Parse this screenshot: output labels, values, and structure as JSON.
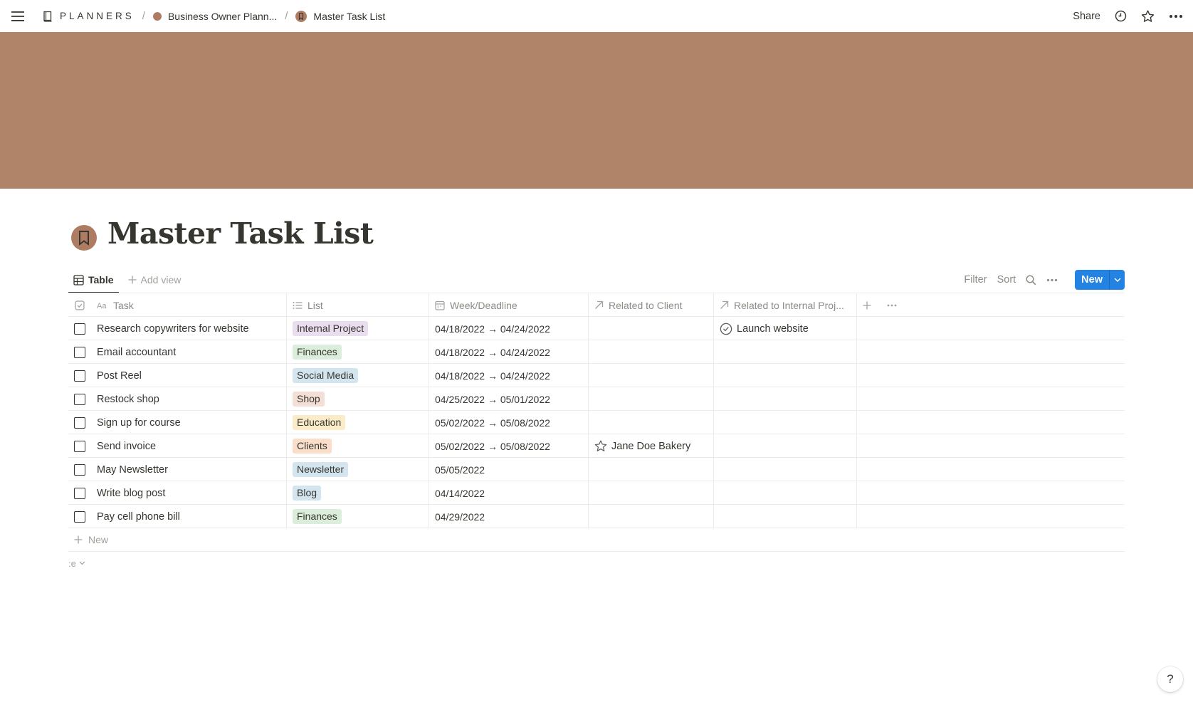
{
  "topbar": {
    "menu_icon": "hamburger-icon",
    "breadcrumbs": [
      {
        "label": "PLANNERS",
        "icon": "book-icon"
      },
      {
        "label": "Business Owner Plann...",
        "icon": "brown-dot-icon"
      },
      {
        "label": "Master Task List",
        "icon": "bookmark-icon"
      }
    ],
    "share_label": "Share",
    "right_icons": [
      "clock-icon",
      "star-icon",
      "more-icon"
    ]
  },
  "colors": {
    "cover": "#b08468",
    "page_icon_bg": "#ae7c62",
    "accent_blue": "#2383e2",
    "text": "#37352f",
    "muted": "#8e8b86"
  },
  "page": {
    "title": "Master Task List",
    "icon": "bookmark-icon"
  },
  "viewbar": {
    "tabs": [
      {
        "label": "Table",
        "icon": "table-icon",
        "active": true
      }
    ],
    "add_view_label": "Add view",
    "filter_label": "Filter",
    "sort_label": "Sort",
    "new_label": "New"
  },
  "table": {
    "columns": [
      {
        "key": "task",
        "label": "Task",
        "icon": "text-aa-icon"
      },
      {
        "key": "list",
        "label": "List",
        "icon": "list-icon"
      },
      {
        "key": "date",
        "label": "Week/Deadline",
        "icon": "calendar-icon"
      },
      {
        "key": "client",
        "label": "Related to Client",
        "icon": "arrow-up-right-icon"
      },
      {
        "key": "internal",
        "label": "Related to Internal Proj...",
        "icon": "arrow-up-right-icon"
      }
    ],
    "rows": [
      {
        "task": "Research copywriters for website",
        "tag": "Internal Project",
        "tag_color": "#e8deee",
        "date": "04/18/2022 → 04/24/2022",
        "client": "",
        "internal": "Launch website"
      },
      {
        "task": "Email accountant",
        "tag": "Finances",
        "tag_color": "#dbeddb",
        "date": "04/18/2022 → 04/24/2022",
        "client": "",
        "internal": ""
      },
      {
        "task": "Post Reel",
        "tag": "Social Media",
        "tag_color": "#d3e5ef",
        "date": "04/18/2022 → 04/24/2022",
        "client": "",
        "internal": ""
      },
      {
        "task": "Restock shop",
        "tag": "Shop",
        "tag_color": "#f4dfd6",
        "date": "04/25/2022 → 05/01/2022",
        "client": "",
        "internal": ""
      },
      {
        "task": "Sign up for course",
        "tag": "Education",
        "tag_color": "#fbecc9",
        "date": "05/02/2022 → 05/08/2022",
        "client": "",
        "internal": ""
      },
      {
        "task": "Send invoice",
        "tag": "Clients",
        "tag_color": "#fadec9",
        "date": "05/02/2022 → 05/08/2022",
        "client": "Jane Doe Bakery",
        "internal": ""
      },
      {
        "task": "May Newsletter",
        "tag": "Newsletter",
        "tag_color": "#d3e5ef",
        "date": "05/05/2022",
        "client": "",
        "internal": ""
      },
      {
        "task": "Write blog post",
        "tag": "Blog",
        "tag_color": "#d3e5ef",
        "date": "04/14/2022",
        "client": "",
        "internal": ""
      },
      {
        "task": "Pay cell phone bill",
        "tag": "Finances",
        "tag_color": "#dbeddb",
        "date": "04/29/2022",
        "client": "",
        "internal": ""
      }
    ],
    "new_row_label": "New",
    "calc_label": ":e"
  },
  "help_label": "?"
}
